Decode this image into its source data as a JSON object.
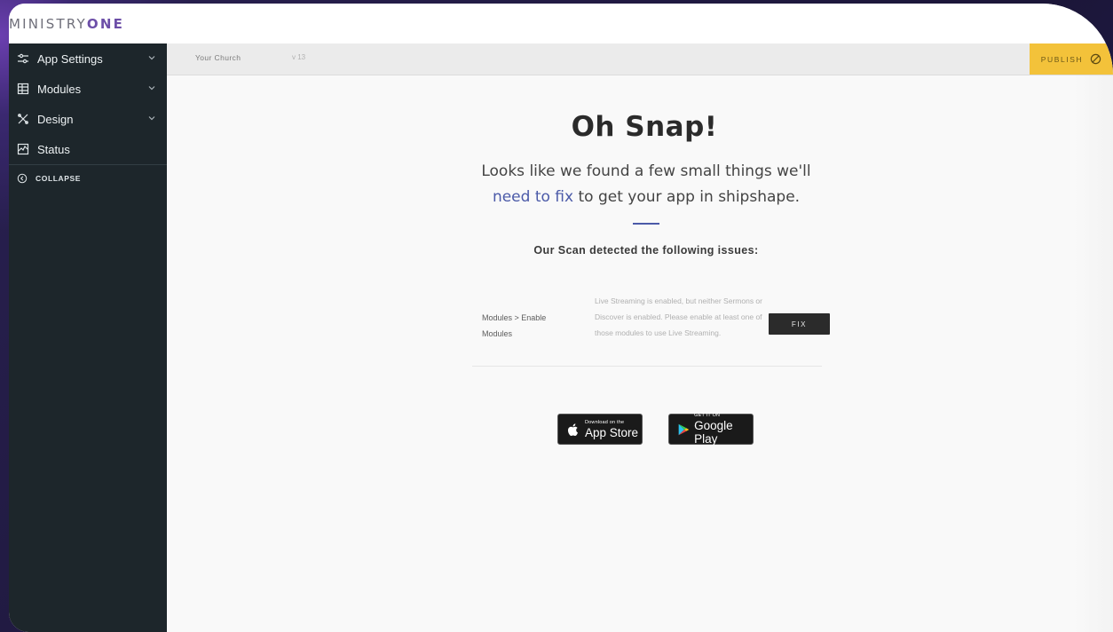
{
  "brand": {
    "logo_light": "MINISTRY",
    "logo_bold": "ONE"
  },
  "sidebar": {
    "items": [
      {
        "label": "App Settings",
        "icon": "sliders-icon",
        "has_chevron": true
      },
      {
        "label": "Modules",
        "icon": "modules-icon",
        "has_chevron": true
      },
      {
        "label": "Design",
        "icon": "design-tools-icon",
        "has_chevron": true
      },
      {
        "label": "Status",
        "icon": "activity-chart-icon",
        "has_chevron": false
      }
    ],
    "collapse_label": "COLLAPSE"
  },
  "topbar": {
    "church_name": "Your Church",
    "version": "v 13",
    "publish_label": "PUBLISH",
    "publish_color": "#f3c23a"
  },
  "main": {
    "title": "Oh Snap!",
    "subtitle_before": "Looks like we found a few small things we'll ",
    "subtitle_link": "need to fix",
    "subtitle_after": " to get your app in shipshape.",
    "accent_color": "#4b5aa8",
    "scan_heading": "Our Scan detected the following issues:",
    "issues": [
      {
        "path": "Modules > Enable Modules",
        "description": "Live Streaming is enabled, but neither Sermons or Discover is enabled. Please enable at least one of those modules to use Live Streaming.",
        "fix_label": "FIX"
      }
    ],
    "badges": {
      "apple": {
        "small": "Download on the",
        "big": "App Store"
      },
      "google": {
        "small": "GET IT ON",
        "big": "Google Play"
      }
    }
  }
}
